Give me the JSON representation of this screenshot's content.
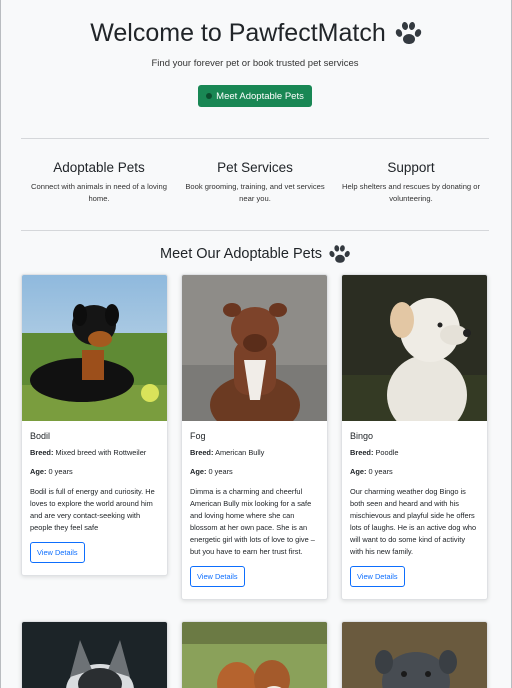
{
  "hero": {
    "title": "Welcome to PawfectMatch",
    "subtitle": "Find your forever pet or book trusted pet services",
    "cta_label": "Meet Adoptable Pets"
  },
  "features": [
    {
      "title": "Adoptable Pets",
      "text": "Connect with animals in need of a loving home."
    },
    {
      "title": "Pet Services",
      "text": "Book grooming, training, and vet services near you."
    },
    {
      "title": "Support",
      "text": "Help shelters and rescues by donating or volunteering."
    }
  ],
  "pets_section": {
    "title": "Meet Our Adoptable Pets"
  },
  "labels": {
    "breed": "Breed:",
    "age": "Age:",
    "details_button": "View Details"
  },
  "pets": [
    {
      "name": "Bodil",
      "breed": "Mixed breed with Rottweiler",
      "age": "0 years",
      "description": "Bodil is full of energy and curiosity. He loves to explore the world around him and are very contact-seeking with people they feel safe"
    },
    {
      "name": "Fog",
      "breed": "American Bully",
      "age": "0 years",
      "description": "Dimma is a charming and cheerful American Bully mix looking for a safe and loving home where she can blossom at her own pace. She is an energetic girl with lots of love to give – but you have to earn her trust first."
    },
    {
      "name": "Bingo",
      "breed": "Poodle",
      "age": "0 years",
      "description": "Our charming weather dog Bingo is both seen and heard and with his mischievous and playful side he offers lots of laughs. He is an active dog who will want to do some kind of activity with his new family."
    }
  ],
  "colors": {
    "cta": "#198754",
    "link": "#0d6efd",
    "background": "#f8f9fa"
  },
  "icons": {
    "title_icon": "paw-icon",
    "section_icon": "paw-icon"
  }
}
